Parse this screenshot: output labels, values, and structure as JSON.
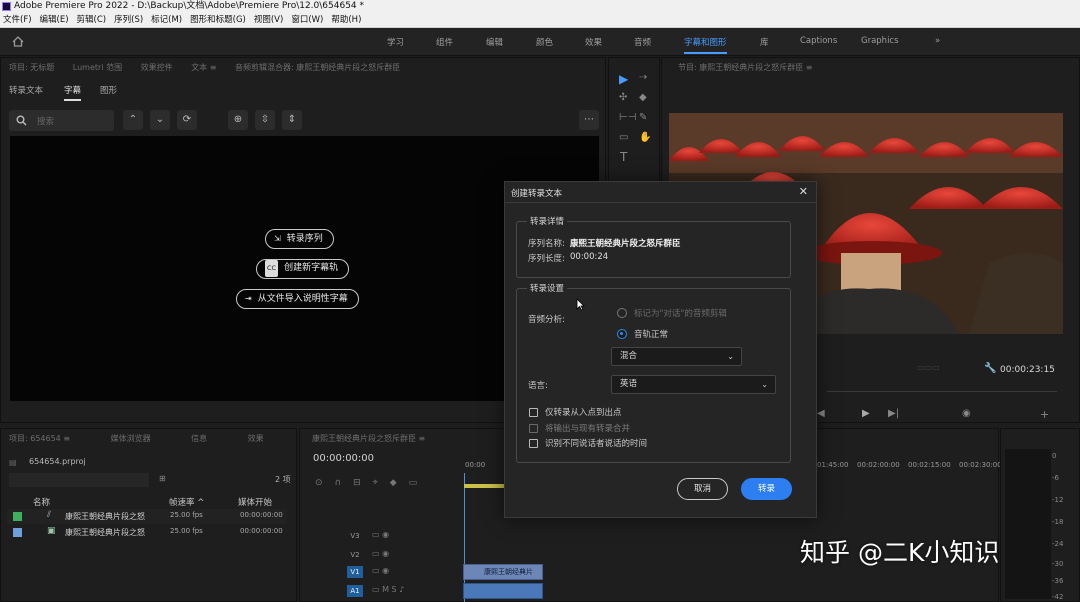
{
  "window": {
    "title": "Adobe Premiere Pro 2022 - D:\\Backup\\文档\\Adobe\\Premiere Pro\\12.0\\654654 *"
  },
  "menu": [
    "文件(F)",
    "编辑(E)",
    "剪辑(C)",
    "序列(S)",
    "标记(M)",
    "图形和标题(G)",
    "视图(V)",
    "窗口(W)",
    "帮助(H)"
  ],
  "workspaces": [
    "学习",
    "组件",
    "编辑",
    "颜色",
    "效果",
    "音频",
    "字幕和图形",
    "库",
    "Captions",
    "Graphics"
  ],
  "active_workspace": "字幕和图形",
  "left_panel": {
    "tabs_dim": [
      "项目: 无标题",
      "Lumetri 范围",
      "效果控件",
      "文本 ≡",
      "音频剪辑混合器: 康熙王朝经典片段之怒斥群臣"
    ],
    "subtabs": [
      "转录文本",
      "字幕",
      "图形"
    ],
    "active_subtab": "字幕",
    "search_placeholder": "搜索",
    "buttons": {
      "transcribe_sequence": "转录序列",
      "create_caption_track": "创建新字幕轨",
      "import_from_file": "从文件导入说明性字幕"
    }
  },
  "right_panel": {
    "tab": "节目: 康熙王朝经典片段之怒斥群臣 ≡",
    "timecode": "00:00:23:15"
  },
  "dialog": {
    "title": "创建转录文本",
    "close": "✕",
    "details_legend": "转录详情",
    "sequence_name_label": "序列名称:",
    "sequence_name": "康熙王朝经典片段之怒斥群臣",
    "sequence_length_label": "序列长度:",
    "sequence_length": "00:00:24",
    "settings_legend": "转录设置",
    "audio_analysis_label": "音频分析:",
    "radio_dialogue": "标记为\"对话\"的音频剪辑",
    "radio_track": "音轨正常",
    "track_select": "混合",
    "language_label": "语言:",
    "language_select": "英语",
    "check_in_out": "仅转录从入点到出点",
    "check_merge": "将输出与现有转录合并",
    "check_speakers": "识别不同说话者说话的时间",
    "cancel": "取消",
    "transcribe": "转录"
  },
  "project_panel": {
    "tabs": [
      "项目: 654654 ≡",
      "媒体浏览器",
      "信息",
      "效果"
    ],
    "file": "654654.prproj",
    "item_count": "2 项",
    "col_name": "名称",
    "col_rate": "帧速率 ^",
    "col_start": "媒体开始",
    "rows": [
      {
        "name": "康熙王朝经典片段之怒",
        "rate": "25.00 fps",
        "start": "00:00:00:00",
        "color": "#3fae5f"
      },
      {
        "name": "康熙王朝经典片段之怒",
        "rate": "25.00 fps",
        "start": "00:00:00:00",
        "color": "#6f9fd8"
      }
    ]
  },
  "timeline": {
    "tab": "康熙王朝经典片段之怒斥群臣 ≡",
    "timecode": "00:00:00:00",
    "ruler": [
      "00:00",
      "01:45:00",
      "00:02:00:00",
      "00:02:15:00",
      "00:02:30:00"
    ],
    "tracks": [
      "V3",
      "V2",
      "V1",
      "A1"
    ],
    "clip_label": "康熙王朝经典片"
  },
  "meter": [
    "0",
    "-6",
    "-12",
    "-18",
    "-24",
    "-30",
    "-36",
    "-42"
  ],
  "watermark": "知乎 @二K小知识"
}
